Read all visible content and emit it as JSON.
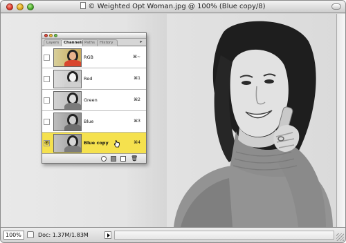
{
  "window": {
    "title": "© Weighted Opt Woman.jpg @ 100% (Blue copy/8)"
  },
  "status_bar": {
    "zoom": "100%",
    "doc_info": "Doc: 1.37M/1.83M"
  },
  "panel": {
    "tabs": [
      {
        "label": "Layers",
        "active": false
      },
      {
        "label": "Channels",
        "active": true
      },
      {
        "label": "Paths",
        "active": false
      },
      {
        "label": "History",
        "active": false
      }
    ],
    "menu_icon": "panel-menu-arrow",
    "channels": [
      {
        "name": "RGB",
        "shortcut": "⌘~",
        "visible": false,
        "selected": false,
        "thumb_color": "#c9b063"
      },
      {
        "name": "Red",
        "shortcut": "⌘1",
        "visible": false,
        "selected": false,
        "thumb_color": "#c8c8c8"
      },
      {
        "name": "Green",
        "shortcut": "⌘2",
        "visible": false,
        "selected": false,
        "thumb_color": "#bdbdbd"
      },
      {
        "name": "Blue",
        "shortcut": "⌘3",
        "visible": false,
        "selected": false,
        "thumb_color": "#9e9e9e"
      },
      {
        "name": "Blue copy",
        "shortcut": "⌘4",
        "visible": true,
        "selected": true,
        "thumb_color": "#a8a8a8"
      }
    ],
    "eye_glyph": "👁",
    "footer_icons": [
      "load-selection-icon",
      "save-selection-icon",
      "new-channel-icon",
      "trash-icon"
    ],
    "trash_glyph": "🗑"
  },
  "colors": {
    "selected_row": "#f5e14e"
  }
}
